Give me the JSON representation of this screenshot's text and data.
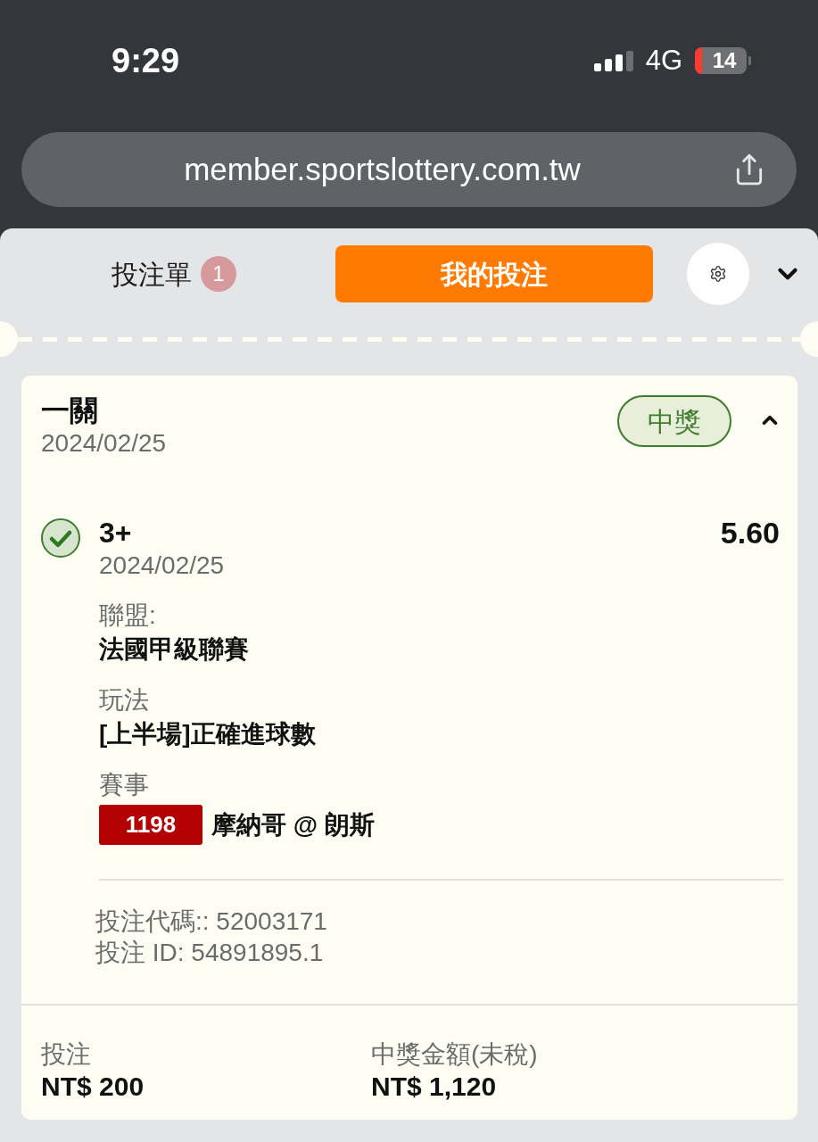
{
  "status_bar": {
    "time": "9:29",
    "network": "4G",
    "battery": "14"
  },
  "browser": {
    "url": "member.sportslottery.com.tw"
  },
  "tabs": [
    {
      "label": "投注單",
      "count": "1",
      "selected": false
    },
    {
      "label": "我的投注",
      "selected": true
    }
  ],
  "bet": {
    "type": "一關",
    "date": "2024/02/25",
    "status": "中獎",
    "expanded": true,
    "selections": [
      {
        "won": true,
        "pick": "3+",
        "odds": "5.60",
        "date": "2024/02/25",
        "fields": [
          {
            "kind": "text",
            "label": "聯盟:",
            "value": "法國甲級聯賽"
          },
          {
            "kind": "text",
            "label": "玩法",
            "value": "[上半場]正確進球數"
          },
          {
            "kind": "match",
            "label": "賽事",
            "match_no": "1198",
            "value": "摩納哥 @ 朗斯"
          }
        ]
      }
    ],
    "ids": [
      "投注代碼:: 52003171",
      "投注 ID: 54891895.1"
    ],
    "summary": [
      {
        "label": "投注",
        "value": "NT$ 200"
      },
      {
        "label": "中獎金額(未稅)",
        "value": "NT$ 1,120"
      }
    ]
  }
}
